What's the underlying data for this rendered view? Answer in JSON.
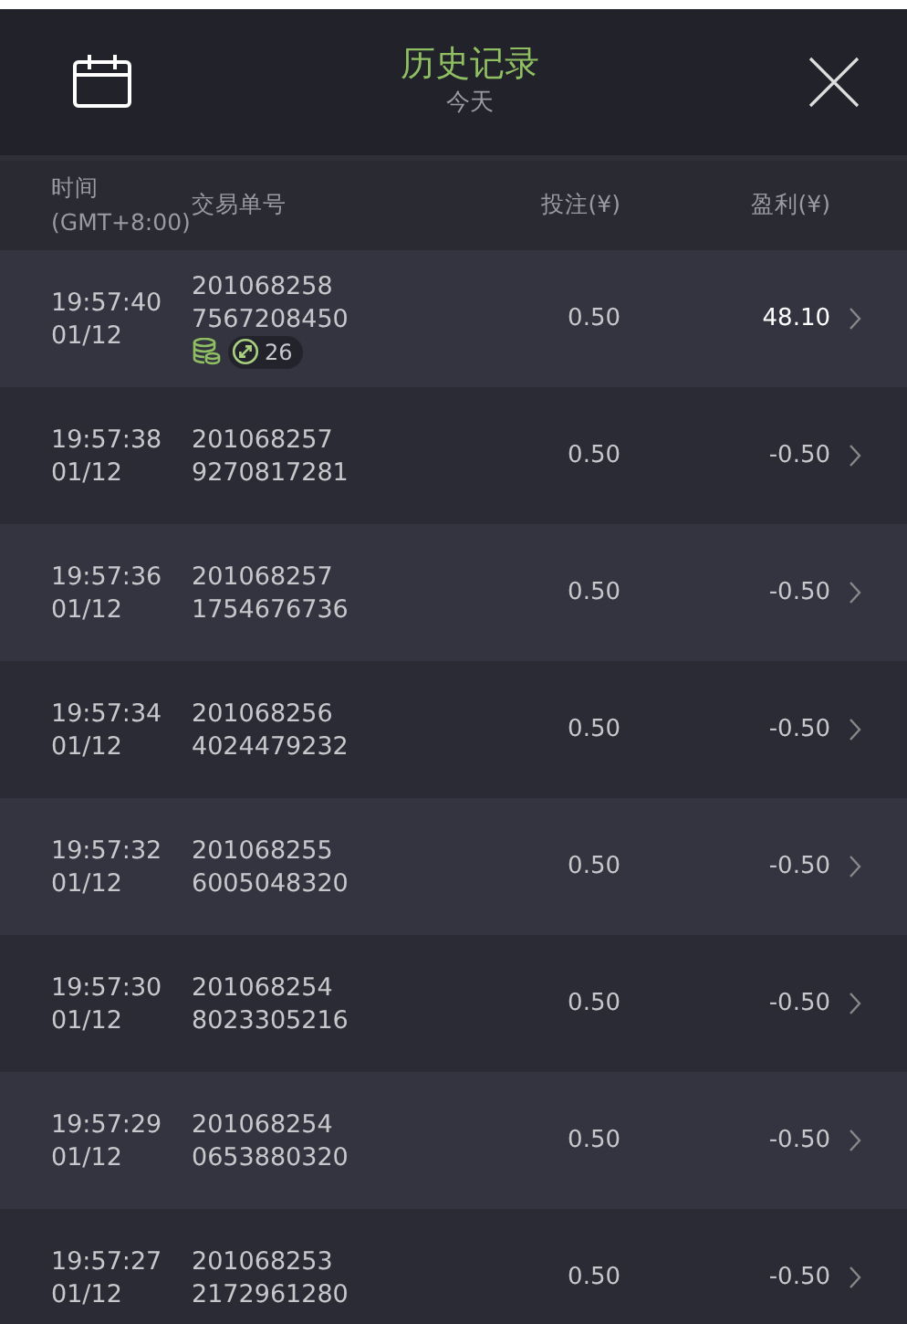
{
  "header": {
    "title": "历史记录",
    "subtitle": "今天"
  },
  "columns": [
    {
      "lines": [
        "时间",
        "(GMT+8:00)"
      ]
    },
    {
      "lines": [
        "交易单号"
      ]
    },
    {
      "lines": [
        "投注(¥)"
      ]
    },
    {
      "lines": [
        "盈利(¥)"
      ]
    }
  ],
  "rows": [
    {
      "time": "19:57:40",
      "date": "01/12",
      "order": [
        "201068258",
        "7567208450"
      ],
      "stake": "0.50",
      "profit": "48.10",
      "won": true,
      "multiplier": "26"
    },
    {
      "time": "19:57:38",
      "date": "01/12",
      "order": [
        "201068257",
        "9270817281"
      ],
      "stake": "0.50",
      "profit": "-0.50",
      "won": false
    },
    {
      "time": "19:57:36",
      "date": "01/12",
      "order": [
        "201068257",
        "1754676736"
      ],
      "stake": "0.50",
      "profit": "-0.50",
      "won": false
    },
    {
      "time": "19:57:34",
      "date": "01/12",
      "order": [
        "201068256",
        "4024479232"
      ],
      "stake": "0.50",
      "profit": "-0.50",
      "won": false
    },
    {
      "time": "19:57:32",
      "date": "01/12",
      "order": [
        "201068255",
        "6005048320"
      ],
      "stake": "0.50",
      "profit": "-0.50",
      "won": false
    },
    {
      "time": "19:57:30",
      "date": "01/12",
      "order": [
        "201068254",
        "8023305216"
      ],
      "stake": "0.50",
      "profit": "-0.50",
      "won": false
    },
    {
      "time": "19:57:29",
      "date": "01/12",
      "order": [
        "201068254",
        "0653880320"
      ],
      "stake": "0.50",
      "profit": "-0.50",
      "won": false
    },
    {
      "time": "19:57:27",
      "date": "01/12",
      "order": [
        "201068253",
        "2172961280"
      ],
      "stake": "0.50",
      "profit": "-0.50",
      "won": false
    }
  ]
}
